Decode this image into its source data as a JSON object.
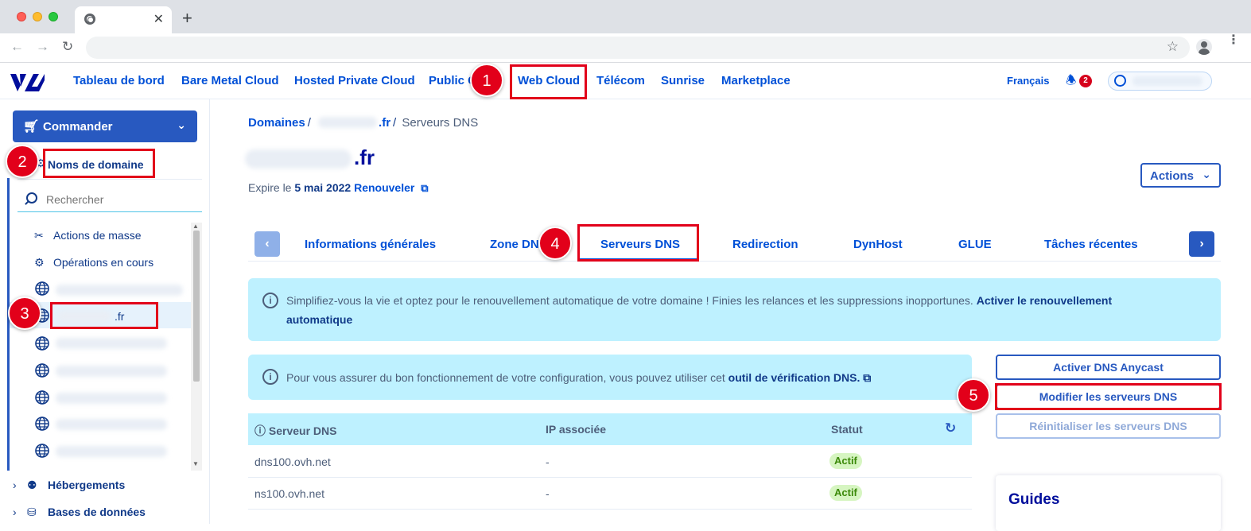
{
  "browser": {
    "tab_close": "✕",
    "new_tab": "+"
  },
  "topnav": {
    "items": [
      "Tableau de bord",
      "Bare Metal Cloud",
      "Hosted Private Cloud",
      "Public C",
      "Web Cloud",
      "Télécom",
      "Sunrise",
      "Marketplace"
    ],
    "language": "Français",
    "notification_count": "2"
  },
  "sidebar": {
    "order_button": "Commander",
    "domains_title": "Noms de domaine",
    "search_placeholder": "Rechercher",
    "bulk_actions": "Actions de masse",
    "ongoing_operations": "Opérations en cours",
    "selected_domain_suffix": ".fr",
    "categories": [
      "Hébergements",
      "Bases de données"
    ]
  },
  "main": {
    "breadcrumb": {
      "root": "Domaines",
      "domain_suffix": ".fr",
      "current": "Serveurs DNS"
    },
    "title_suffix": ".fr",
    "expire_prefix": "Expire le",
    "expire_date": "5 mai 2022",
    "renew_link": "Renouveler",
    "actions_button": "Actions",
    "tabs": [
      "Informations générales",
      "Zone DN",
      "Serveurs DNS",
      "Redirection",
      "DynHost",
      "GLUE",
      "Tâches récentes"
    ],
    "auto_renew_info": "Simplifiez-vous la vie et optez pour le renouvellement automatique de votre domaine ! Finies les relances et les suppressions inopportunes.",
    "auto_renew_link_1": "Activer le renouvellement",
    "auto_renew_link_2": "automatique",
    "dns_check_info": "Pour vous assurer du bon fonctionnement de votre configuration, vous pouvez utiliser cet",
    "dns_check_link": "outil de vérification DNS.",
    "buttons": {
      "anycast": "Activer DNS Anycast",
      "modify": "Modifier les serveurs DNS",
      "reset": "Réinitialiser les serveurs DNS"
    },
    "table": {
      "headers": [
        "Serveur DNS",
        "IP associée",
        "Statut"
      ],
      "rows": [
        {
          "server": "dns100.ovh.net",
          "ip": "-",
          "status": "Actif"
        },
        {
          "server": "ns100.ovh.net",
          "ip": "-",
          "status": "Actif"
        }
      ]
    },
    "guides_title": "Guides"
  },
  "annotations": [
    "1",
    "2",
    "3",
    "4",
    "5"
  ],
  "colors": {
    "brand_blue": "#0050d7",
    "primary_button": "#2859c0",
    "info_background": "#bef1ff",
    "annotation_red": "#e2001a",
    "active_badge": "#d6f5c1"
  }
}
